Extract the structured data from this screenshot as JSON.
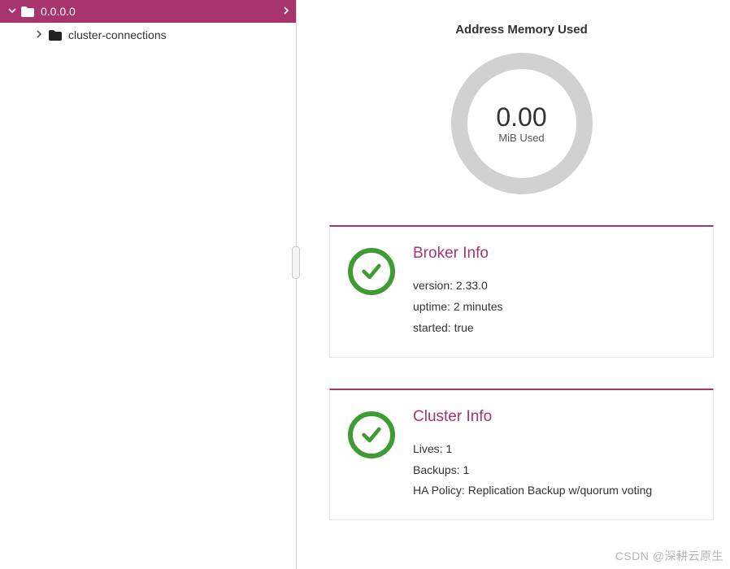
{
  "sidebar": {
    "root": {
      "label": "0.0.0.0"
    },
    "children": [
      {
        "label": "cluster-connections"
      }
    ]
  },
  "gauge": {
    "title": "Address Memory Used",
    "value": "0.00",
    "unit": "MiB Used"
  },
  "broker_card": {
    "title": "Broker Info",
    "lines": {
      "version_label": "version:",
      "version_value": "2.33.0",
      "uptime_label": "uptime:",
      "uptime_value": "2 minutes",
      "started_label": "started:",
      "started_value": "true"
    }
  },
  "cluster_card": {
    "title": "Cluster Info",
    "lines": {
      "lives_label": "Lives:",
      "lives_value": "1",
      "backups_label": "Backups:",
      "backups_value": "1",
      "ha_label": "HA Policy:",
      "ha_value": "Replication Backup w/quorum voting"
    }
  },
  "watermark": "CSDN @深耕云原生",
  "chart_data": {
    "type": "pie",
    "title": "Address Memory Used",
    "unit": "MiB",
    "used": 0.0,
    "total": null,
    "series": [
      {
        "name": "Used",
        "value": 0.0
      }
    ]
  }
}
